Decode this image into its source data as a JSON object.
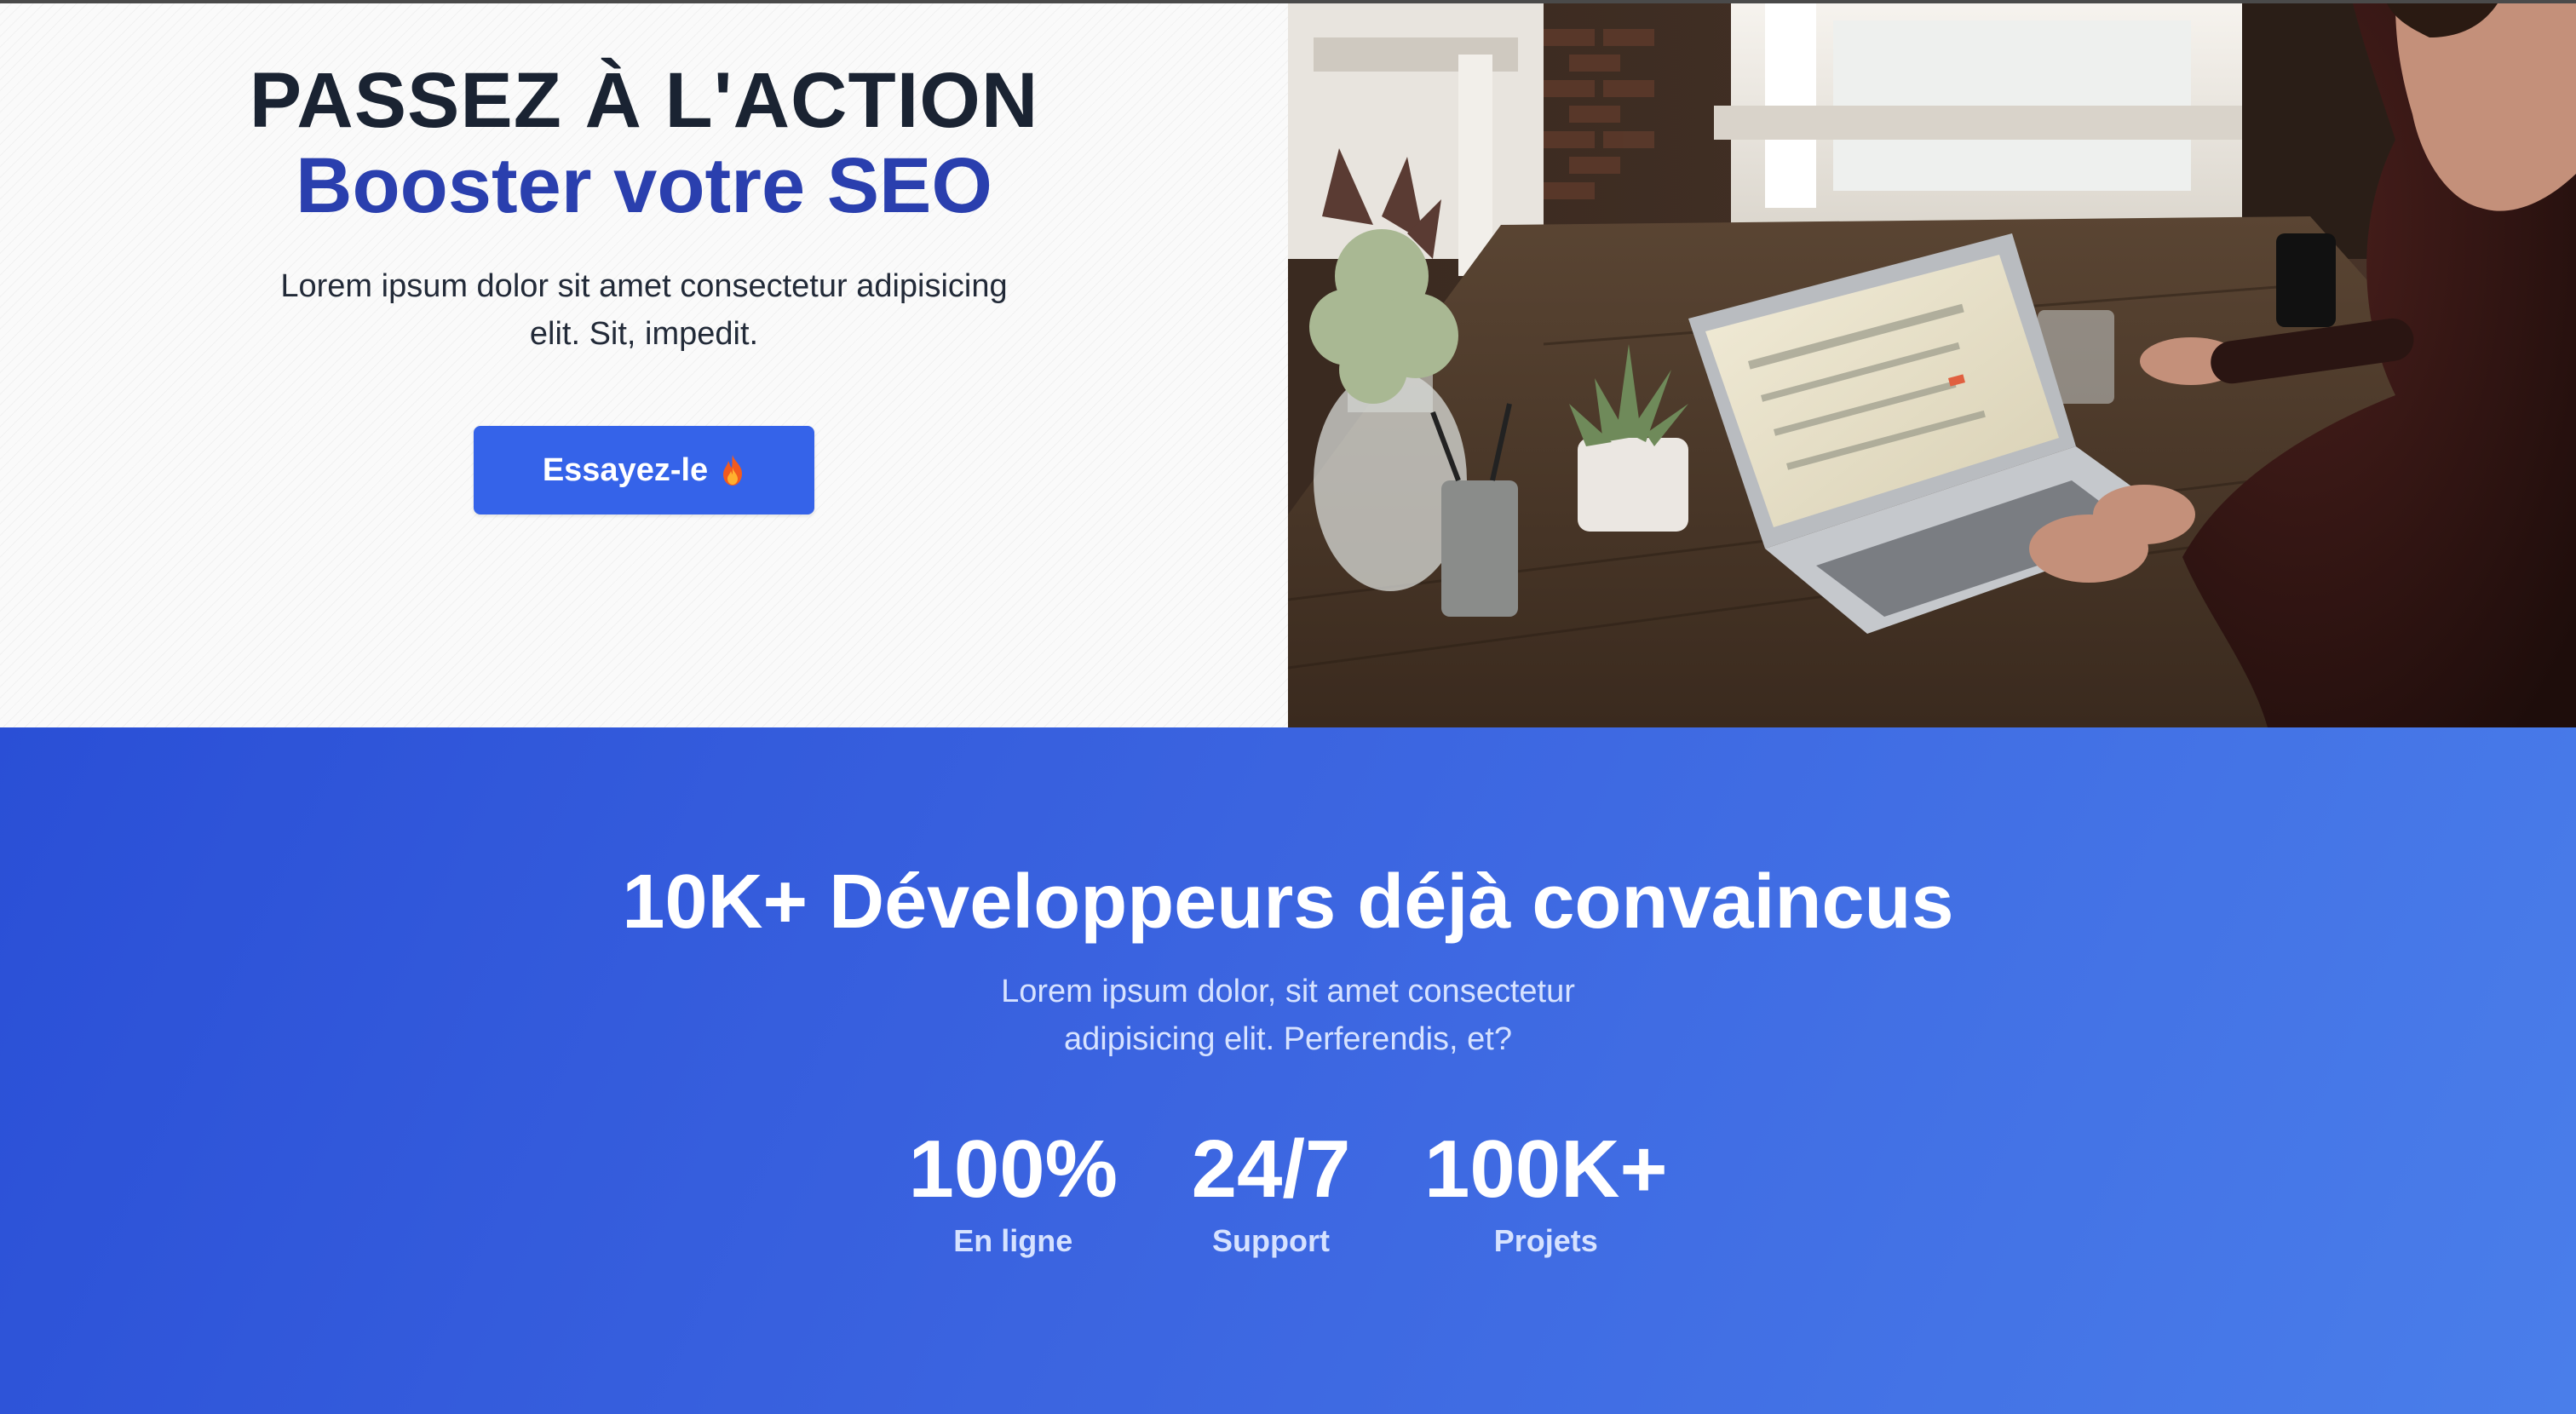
{
  "hero": {
    "kicker": "PASSEZ À L'ACTION",
    "headline": "Booster votre SEO",
    "lead": "Lorem ipsum dolor sit amet consectetur adipisicing elit. Sit, impedit.",
    "cta_label": "Essayez-le",
    "cta_icon": "flame-icon",
    "photo": "person-working-on-laptop-photo"
  },
  "stats": {
    "title": "10K+ Développeurs déjà convaincus",
    "subtitle": "Lorem ipsum dolor, sit amet consectetur adipisicing elit. Perferendis, et?",
    "items": [
      {
        "value": "100%",
        "label": "En ligne"
      },
      {
        "value": "24/7",
        "label": "Support"
      },
      {
        "value": "100K+",
        "label": "Projets"
      }
    ]
  },
  "colors": {
    "accent": "#3563e9",
    "headline_blue": "#2a3fae",
    "dark_text": "#1a2332",
    "gradient_start": "#2a4fd6",
    "gradient_end": "#4a7eea"
  }
}
